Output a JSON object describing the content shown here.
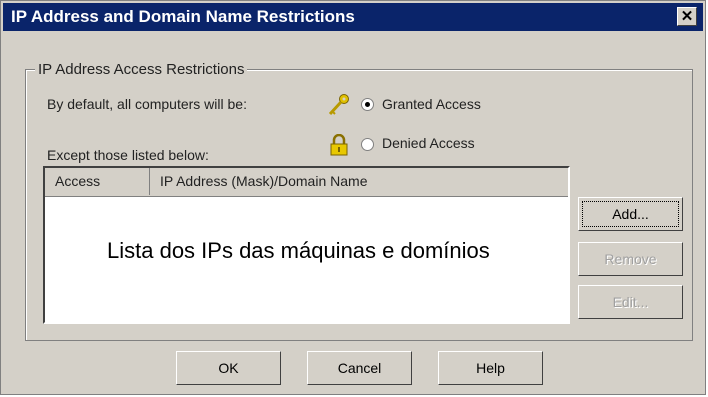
{
  "window": {
    "title": "IP Address and Domain Name Restrictions",
    "close_glyph": "✕"
  },
  "group": {
    "title": "IP Address Access Restrictions"
  },
  "default_label": "By default, all computers will be:",
  "options": {
    "granted": {
      "label": "Granted Access",
      "checked": true,
      "icon": "key-icon"
    },
    "denied": {
      "label": "Denied Access",
      "checked": false,
      "icon": "lock-icon"
    }
  },
  "except_label": "Except those listed below:",
  "list": {
    "columns": [
      "Access",
      "IP Address (Mask)/Domain Name"
    ],
    "overlay_text": "Lista dos IPs das máquinas e domínios"
  },
  "side_buttons": {
    "add": "Add...",
    "remove": "Remove",
    "edit": "Edit..."
  },
  "footer_buttons": {
    "ok": "OK",
    "cancel": "Cancel",
    "help": "Help"
  },
  "colors": {
    "titlebar": "#0a246a",
    "face": "#d4d0c8",
    "key": "#d8b400"
  }
}
